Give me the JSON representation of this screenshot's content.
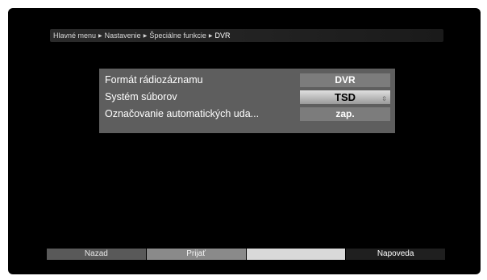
{
  "breadcrumb": {
    "items": [
      "Hlavné menu",
      "Nastavenie",
      "Špeciálne funkcie",
      "DVR"
    ],
    "separator": "▶"
  },
  "settings": {
    "rows": [
      {
        "label": "Formát rádiozáznamu",
        "value": "DVR"
      },
      {
        "label": "Systém súborov",
        "value": "TSD"
      },
      {
        "label": "Označovanie automatických uda...",
        "value": "zap."
      }
    ],
    "selected_row": 1
  },
  "footer": {
    "red_label": "Nazad",
    "green_label": "Prijať",
    "yellow_label": "",
    "blue_label": "Napoveda"
  },
  "colors": {
    "panel": "#5e5e5e",
    "value_box": "#7c7c7c",
    "screen_background": "#000000"
  },
  "icons": {
    "dropdown": "dropdown-arrow-icon"
  }
}
